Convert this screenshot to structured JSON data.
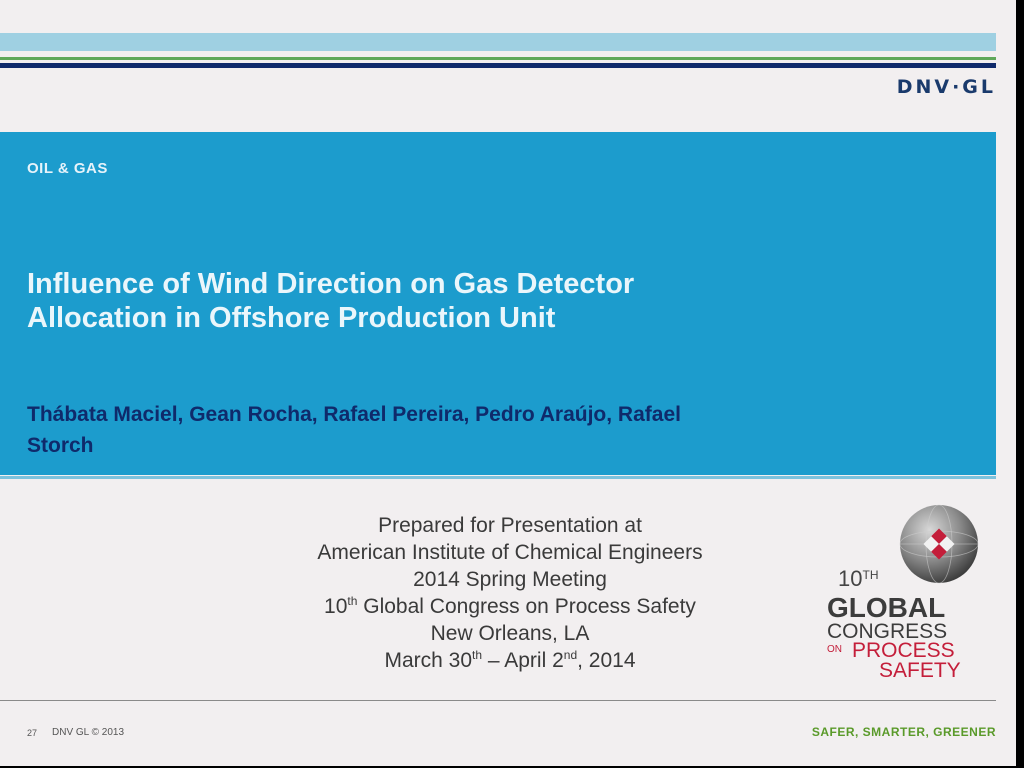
{
  "header": {
    "logo": "DNV·GL"
  },
  "band": {
    "section": "OIL & GAS",
    "title": "Influence of Wind Direction on Gas Detector Allocation in Offshore Production Unit",
    "authors": "Thábata Maciel, Gean Rocha, Rafael Pereira, Pedro Araújo, Rafael Storch"
  },
  "presentation": {
    "line1": "Prepared for Presentation at",
    "line2": "American Institute of Chemical Engineers",
    "line3": "2014 Spring Meeting",
    "line4_num": "10",
    "line4_sup": "th",
    "line4_rest": " Global Congress on Process Safety",
    "line5": "New Orleans, LA",
    "line6_a": "March 30",
    "line6_sup1": "th",
    "line6_b": " – April 2",
    "line6_sup2": "nd",
    "line6_c": ", 2014"
  },
  "conference_logo": {
    "number": "10",
    "number_sup": "TH",
    "word1": "GLOBAL",
    "word2": "CONGRESS",
    "word3": "ON",
    "word4": "PROCESS",
    "word5": "SAFETY"
  },
  "footer": {
    "page": "27",
    "copyright": "DNV GL © 2013",
    "tagline": "SAFER, SMARTER, GREENER"
  },
  "colors": {
    "band": "#1c9ccd",
    "navy": "#0f2a6b",
    "green": "#5a9a2a",
    "red": "#c41e3a"
  }
}
